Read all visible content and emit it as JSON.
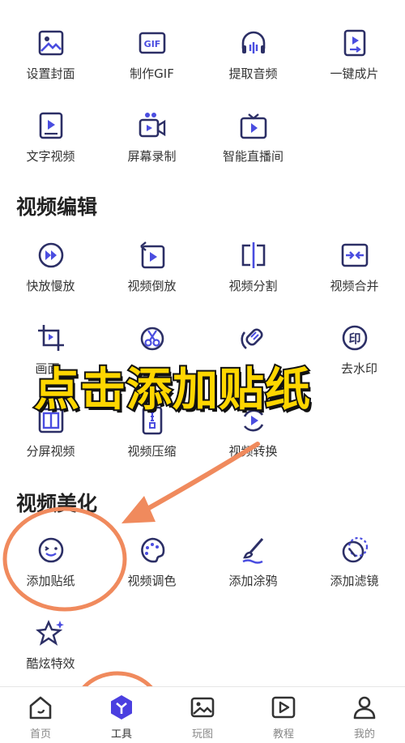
{
  "row1": [
    {
      "label": "设置封面",
      "icon": "image-icon"
    },
    {
      "label": "制作GIF",
      "icon": "gif-icon"
    },
    {
      "label": "提取音频",
      "icon": "headphones-icon"
    },
    {
      "label": "一键成片",
      "icon": "one-click-video-icon"
    }
  ],
  "row2": [
    {
      "label": "文字视频",
      "icon": "text-video-icon"
    },
    {
      "label": "屏幕录制",
      "icon": "screen-record-icon"
    },
    {
      "label": "智能直播间",
      "icon": "tv-icon"
    }
  ],
  "sections": {
    "edit_title": "视频编辑",
    "beauty_title": "视频美化"
  },
  "edit_row1": [
    {
      "label": "快放慢放",
      "icon": "fast-forward-icon"
    },
    {
      "label": "视频倒放",
      "icon": "reverse-icon"
    },
    {
      "label": "视频分割",
      "icon": "split-icon"
    },
    {
      "label": "视频合并",
      "icon": "merge-icon"
    }
  ],
  "edit_row2": [
    {
      "label": "画面",
      "icon": "crop-icon"
    },
    {
      "label": "",
      "icon": "cut-icon"
    },
    {
      "label": "",
      "icon": "eraser-icon"
    },
    {
      "label": "去水印",
      "icon": "watermark-icon"
    }
  ],
  "edit_row3": [
    {
      "label": "分屏视频",
      "icon": "split-screen-icon"
    },
    {
      "label": "视频压缩",
      "icon": "compress-icon"
    },
    {
      "label": "视频转换",
      "icon": "convert-icon"
    }
  ],
  "beauty_row1": [
    {
      "label": "添加贴纸",
      "icon": "sticker-icon"
    },
    {
      "label": "视频调色",
      "icon": "palette-icon"
    },
    {
      "label": "添加涂鸦",
      "icon": "brush-icon"
    },
    {
      "label": "添加滤镜",
      "icon": "filter-icon"
    }
  ],
  "beauty_row2": [
    {
      "label": "酷炫特效",
      "icon": "sparkle-icon"
    }
  ],
  "overlay": {
    "caption": "点击添加贴纸",
    "accent": "#f08a5d",
    "caption_color": "#ffd600"
  },
  "tabbar": {
    "tabs": [
      {
        "label": "首页",
        "icon": "home-icon"
      },
      {
        "label": "工具",
        "icon": "tools-icon",
        "active": true
      },
      {
        "label": "玩图",
        "icon": "picture-icon"
      },
      {
        "label": "教程",
        "icon": "play-icon"
      },
      {
        "label": "我的",
        "icon": "user-icon"
      }
    ]
  },
  "colors": {
    "icon": "#3b3ec8",
    "accent_purple": "#5b4bdb"
  }
}
